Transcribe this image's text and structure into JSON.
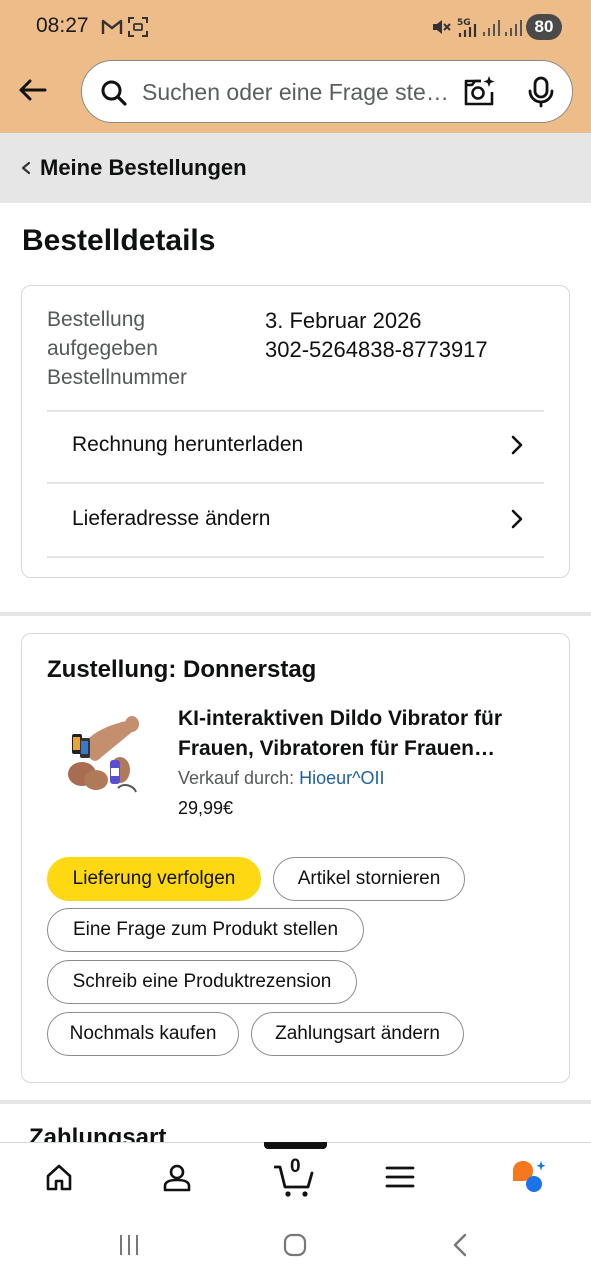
{
  "status_bar": {
    "time": "08:27",
    "battery": "80",
    "icons": [
      "gmail-icon",
      "screenshot-icon",
      "mute-icon",
      "5g-icon",
      "signal-icon",
      "signal-icon"
    ]
  },
  "search": {
    "placeholder": "Suchen oder eine Frage stellen",
    "display_text": "Suchen oder eine Frage ste…"
  },
  "breadcrumb": {
    "label": "Meine Bestellungen"
  },
  "page": {
    "title": "Bestelldetails"
  },
  "order": {
    "placed_label": "Bestellung aufgegeben",
    "placed_label_l1": "Bestellung",
    "placed_label_l2": "aufgegeben",
    "placed_value": "3. Februar 2026",
    "number_label": "Bestellnummer",
    "number_value": "302-5264838-8773917",
    "links": [
      {
        "label": "Rechnung herunterladen"
      },
      {
        "label": "Lieferadresse ändern"
      }
    ]
  },
  "shipment": {
    "title": "Zustellung: Donnerstag",
    "product_title": "KI-interaktiven Dildo Vibrator für Frauen, Vibratoren für Frauen…",
    "product_title_l1": "KI-interaktiven Dildo Vibrator für",
    "product_title_l2": "Frauen, Vibratoren für Frauen…",
    "sold_by_label": "Verkauf durch: ",
    "seller": "Hioeur^OII",
    "price": "29,99€",
    "actions": [
      {
        "label": "Lieferung verfolgen",
        "primary": true
      },
      {
        "label": "Artikel stornieren"
      },
      {
        "label": "Eine Frage zum Produkt stellen"
      },
      {
        "label": "Schreib eine Produktrezension"
      },
      {
        "label": "Nochmals kaufen"
      },
      {
        "label": "Zahlungsart ändern"
      }
    ]
  },
  "payment_section": {
    "title": "Zahlungsart"
  },
  "bottom_nav": {
    "items": [
      "home-icon",
      "account-icon",
      "cart-icon",
      "menu-icon",
      "rufus-icon"
    ],
    "cart_count": "0"
  },
  "colors": {
    "header_bg": "#eebc88",
    "primary_button": "#ffd814",
    "link": "#2162a1",
    "rufus_orange": "#f5781e",
    "rufus_blue": "#1a73e8"
  }
}
